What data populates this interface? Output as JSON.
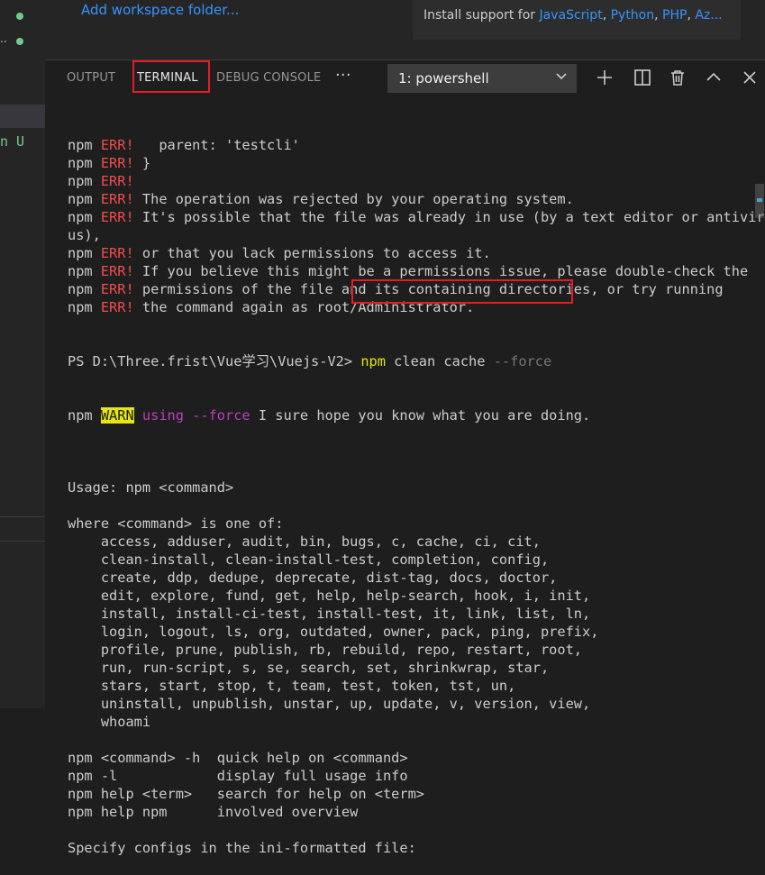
{
  "sidebar": {
    "fragment_dot_label": "..",
    "fragment_text": "n U"
  },
  "top": {
    "add_folder": "Add workspace folder...",
    "ext_prefix": "Install support for ",
    "ext_links": [
      "JavaScript",
      "Python",
      "PHP",
      "Az..."
    ],
    "ext_sep": ", "
  },
  "panel": {
    "tabs": [
      "OUTPUT",
      "TERMINAL",
      "DEBUG CONSOLE"
    ],
    "more": "···",
    "terminal_select": "1: powershell",
    "icons": [
      "add-icon",
      "split-icon",
      "trash-icon",
      "chevron-up-icon",
      "close-icon"
    ]
  },
  "terminal": {
    "pre_lines": [
      {
        "p": "npm ",
        "e": "ERR!",
        "t": "   parent: 'testcli'"
      },
      {
        "p": "npm ",
        "e": "ERR!",
        "t": " }"
      },
      {
        "p": "npm ",
        "e": "ERR!",
        "t": ""
      },
      {
        "p": "npm ",
        "e": "ERR!",
        "t": " The operation was rejected by your operating system."
      },
      {
        "p": "npm ",
        "e": "ERR!",
        "t": " It's possible that the file was already in use (by a text editor or antivir"
      },
      {
        "p": "",
        "e": "",
        "t": "us),"
      },
      {
        "p": "npm ",
        "e": "ERR!",
        "t": " or that you lack permissions to access it."
      },
      {
        "p": "npm ",
        "e": "ERR!",
        "t": " If you believe this might be a permissions issue, please double-check the"
      },
      {
        "p": "npm ",
        "e": "ERR!",
        "t": " permissions of the file and its containing directories, or try running"
      },
      {
        "p": "npm ",
        "e": "ERR!",
        "t": " the command again as root/Administrator."
      }
    ],
    "prompt": "PS D:\\Three.frist\\Vue学习\\Vuejs-V2> ",
    "cmd_npm": "npm",
    "cmd_rest": " clean cache ",
    "cmd_flag": "--force",
    "warn_npm": "npm ",
    "warn_tag": "WARN",
    "warn_using": " using",
    "warn_flag": " --force",
    "warn_rest": " I sure hope you know what you are doing.",
    "post_lines": [
      "",
      "Usage: npm <command>",
      "",
      "where <command> is one of:",
      "    access, adduser, audit, bin, bugs, c, cache, ci, cit,",
      "    clean-install, clean-install-test, completion, config,",
      "    create, ddp, dedupe, deprecate, dist-tag, docs, doctor,",
      "    edit, explore, fund, get, help, help-search, hook, i, init,",
      "    install, install-ci-test, install-test, it, link, list, ln,",
      "    login, logout, ls, org, outdated, owner, pack, ping, prefix,",
      "    profile, prune, publish, rb, rebuild, repo, restart, root,",
      "    run, run-script, s, se, search, set, shrinkwrap, star,",
      "    stars, start, stop, t, team, test, token, tst, un,",
      "    uninstall, unpublish, unstar, up, update, v, version, view,",
      "    whoami",
      "",
      "npm <command> -h  quick help on <command>",
      "npm -l            display full usage info",
      "npm help <term>   search for help on <term>",
      "npm help npm      involved overview",
      "",
      "Specify configs in the ini-formatted file:"
    ]
  },
  "colors": {
    "error": "#f14c4c",
    "warn_bg": "#e5e510",
    "highlight_box": "#e51c23",
    "link": "#3794ff"
  }
}
